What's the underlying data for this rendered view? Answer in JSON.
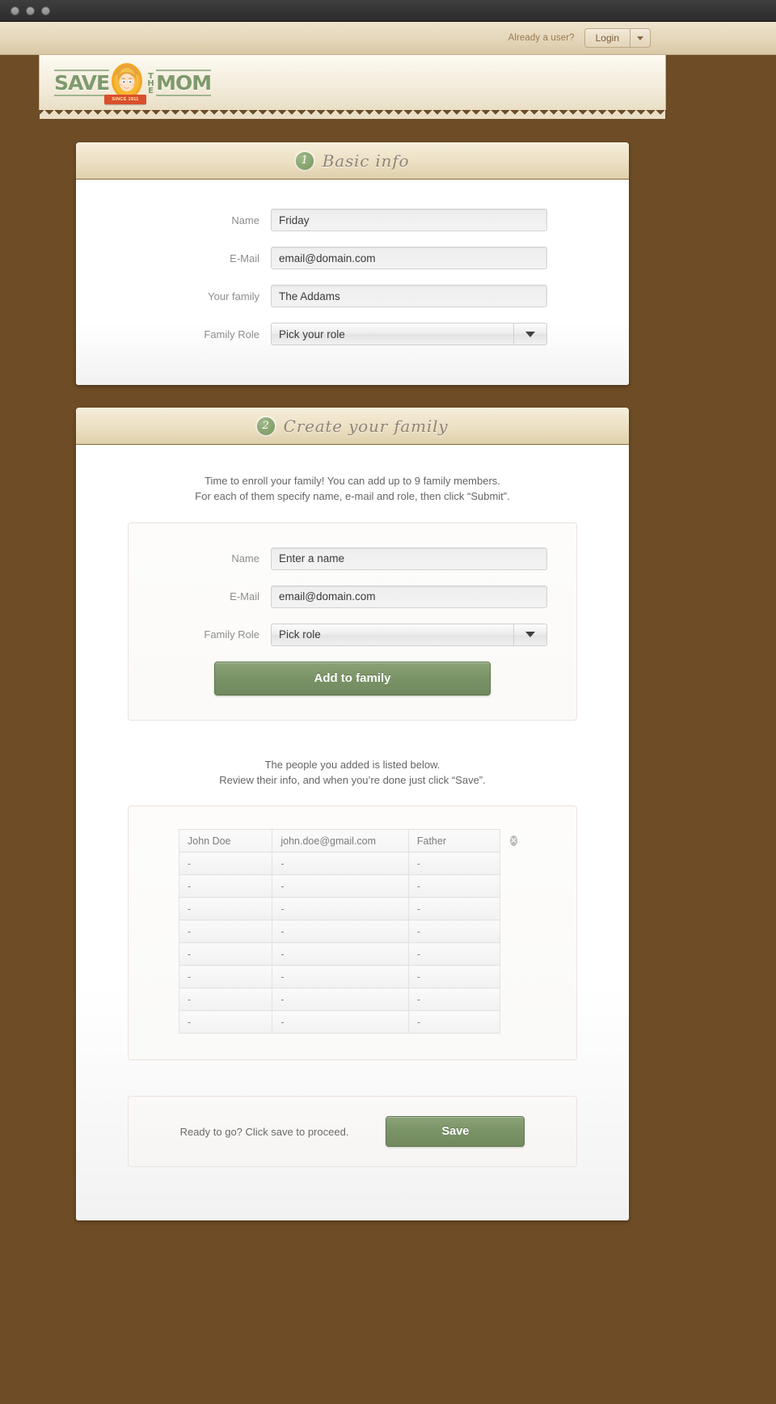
{
  "window": {
    "dots": [
      "close-dot",
      "minimize-dot",
      "zoom-dot"
    ]
  },
  "topbar": {
    "already_user_text": "Already a user?",
    "login_label": "Login",
    "caret_icon": "chevron-down-icon"
  },
  "brand": {
    "word_save": "SAVE",
    "word_the": "THE",
    "word_mom": "MOM",
    "ribbon_text": "SINCE 1911",
    "green": "#7f9a6c",
    "ribbon_red": "#d94f2b"
  },
  "sections": [
    {
      "step": "1",
      "title": "Basic info",
      "fields": [
        {
          "label": "Name",
          "value": "Friday",
          "type": "text"
        },
        {
          "label": "E-Mail",
          "value": "email@domain.com",
          "type": "text"
        },
        {
          "label": "Your family",
          "value": "The Addams",
          "type": "text"
        },
        {
          "label": "Family Role",
          "value": "Pick your role",
          "type": "select"
        }
      ]
    },
    {
      "step": "2",
      "title": "Create your family",
      "intro_line1": "Time to enroll your family! You can add up to 9 family members.",
      "intro_line2": "For each of them specify name, e-mail and role, then click “Submit”.",
      "member_form": {
        "fields": [
          {
            "label": "Name",
            "value": "Enter a name",
            "type": "text"
          },
          {
            "label": "E-Mail",
            "value": "email@domain.com",
            "type": "text"
          },
          {
            "label": "Family Role",
            "value": "Pick role",
            "type": "select"
          }
        ],
        "submit_label": "Add to family"
      },
      "list_line1": "The people you added is listed below.",
      "list_line2": "Review their info, and when you’re done just click “Save”.",
      "table": {
        "rows": [
          {
            "name": "John Doe",
            "email": "john.doe@gmail.com",
            "role": "Father",
            "has_delete": true
          },
          {
            "name": "-",
            "email": "-",
            "role": "-",
            "has_delete": false
          },
          {
            "name": "-",
            "email": "-",
            "role": "-",
            "has_delete": false
          },
          {
            "name": "-",
            "email": "-",
            "role": "-",
            "has_delete": false
          },
          {
            "name": "-",
            "email": "-",
            "role": "-",
            "has_delete": false
          },
          {
            "name": "-",
            "email": "-",
            "role": "-",
            "has_delete": false
          },
          {
            "name": "-",
            "email": "-",
            "role": "-",
            "has_delete": false
          },
          {
            "name": "-",
            "email": "-",
            "role": "-",
            "has_delete": false
          },
          {
            "name": "-",
            "email": "-",
            "role": "-",
            "has_delete": false
          }
        ],
        "delete_icon": "remove-circle-icon",
        "delete_glyph": "✕"
      },
      "save_hint": "Ready to go? Click save to proceed.",
      "save_label": "Save"
    }
  ],
  "colors": {
    "page_bg": "#6d4c26",
    "cream": "#e4d6ba",
    "green_btn": "#7a9366",
    "badge_green": "#83a06b"
  }
}
